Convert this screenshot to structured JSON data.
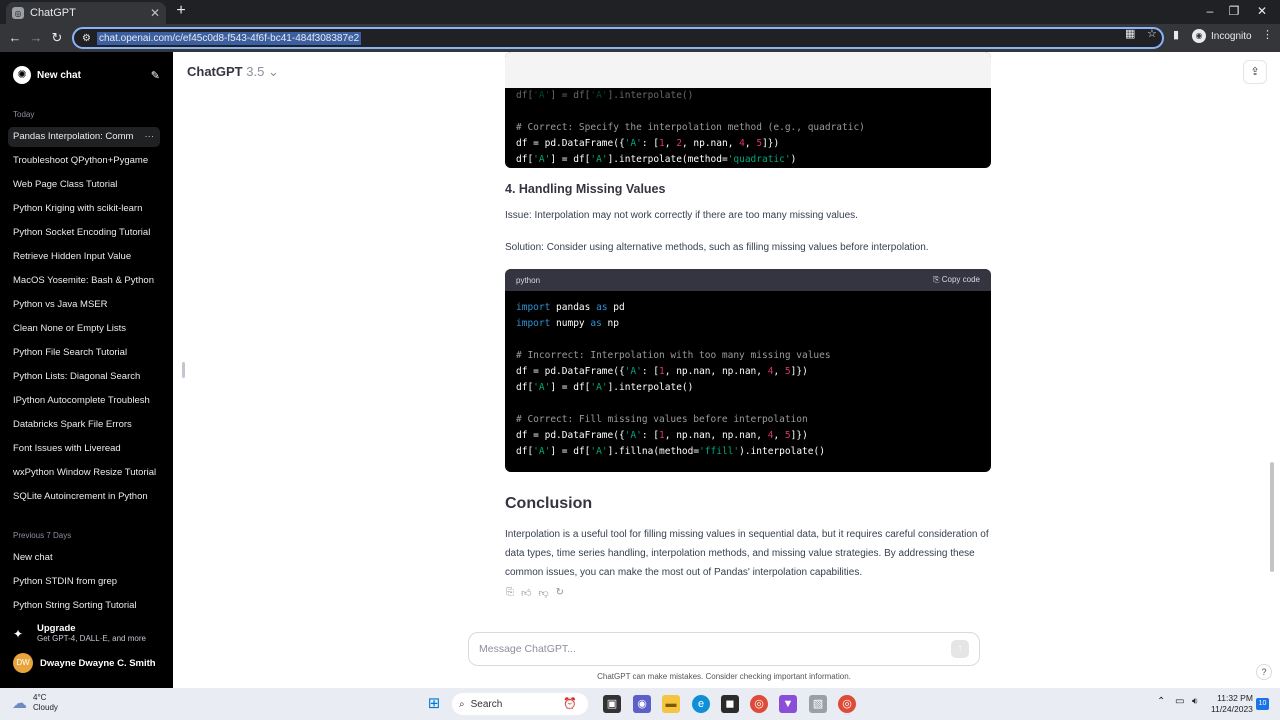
{
  "browser": {
    "tab_title": "ChatGPT",
    "tab_close": "✕",
    "new_tab": "+",
    "url": "chat.openai.com/c/ef45c0d8-f543-4f6f-bc41-484f308387e2",
    "profile_label": "Incognito"
  },
  "sidebar": {
    "new_chat": "New chat",
    "today_label": "Today",
    "today_items": [
      "Pandas Interpolation: Comm",
      "Troubleshoot QPython+Pygame",
      "Web Page Class Tutorial",
      "Python Kriging with scikit-learn",
      "Python Socket Encoding Tutorial",
      "Retrieve Hidden Input Value",
      "MacOS Yosemite: Bash & Python",
      "Python vs Java MSER",
      "Clean None or Empty Lists",
      "Python File Search Tutorial",
      "Python Lists: Diagonal Search",
      "IPython Autocomplete Troublesh",
      "Databricks Spark File Errors",
      "Font Issues with Liveread",
      "wxPython Window Resize Tutorial",
      "SQLite Autoincrement in Python"
    ],
    "previous_label": "Previous 7 Days",
    "previous_items": [
      "New chat",
      "Python STDIN from grep",
      "Python String Sorting Tutorial"
    ],
    "upgrade_title": "Upgrade",
    "upgrade_sub": "Get GPT-4, DALL·E, and more",
    "user_initials": "DW",
    "user_name": "Dwayne Dwayne C. Smith"
  },
  "header": {
    "model": "ChatGPT",
    "version": "3.5"
  },
  "content": {
    "code1": {
      "comment": "# Correct: Specify the interpolation method (e.g., quadratic)"
    },
    "section4_title": "4. Handling Missing Values",
    "issue": "Issue: Interpolation may not work correctly if there are too many missing values.",
    "solution": "Solution: Consider using alternative methods, such as filling missing values before interpolation.",
    "code2": {
      "lang": "python",
      "copy": "Copy code",
      "comment_incorrect": "# Incorrect: Interpolation with too many missing values",
      "comment_correct": "# Correct: Fill missing values before interpolation"
    },
    "conclusion_title": "Conclusion",
    "conclusion_text": "Interpolation is a useful tool for filling missing values in sequential data, but it requires careful consideration of data types, time series handling, interpolation methods, and missing value strategies. By addressing these common issues, you can make the most out of Pandas' interpolation capabilities."
  },
  "composer": {
    "placeholder": "Message ChatGPT...",
    "disclaimer": "ChatGPT can make mistakes. Consider checking important information."
  },
  "taskbar": {
    "temp": "4°C",
    "weather": "Cloudy",
    "search": "Search",
    "time": "11:32 PM",
    "date": "11/24/2023",
    "notifications": "10"
  },
  "colors": {
    "sidebar_bg": "#000000",
    "code_keyword": "#2e95d3",
    "code_string": "#00a67d",
    "code_number": "#df3079",
    "omnibox_focus": "#8ab4f8"
  }
}
